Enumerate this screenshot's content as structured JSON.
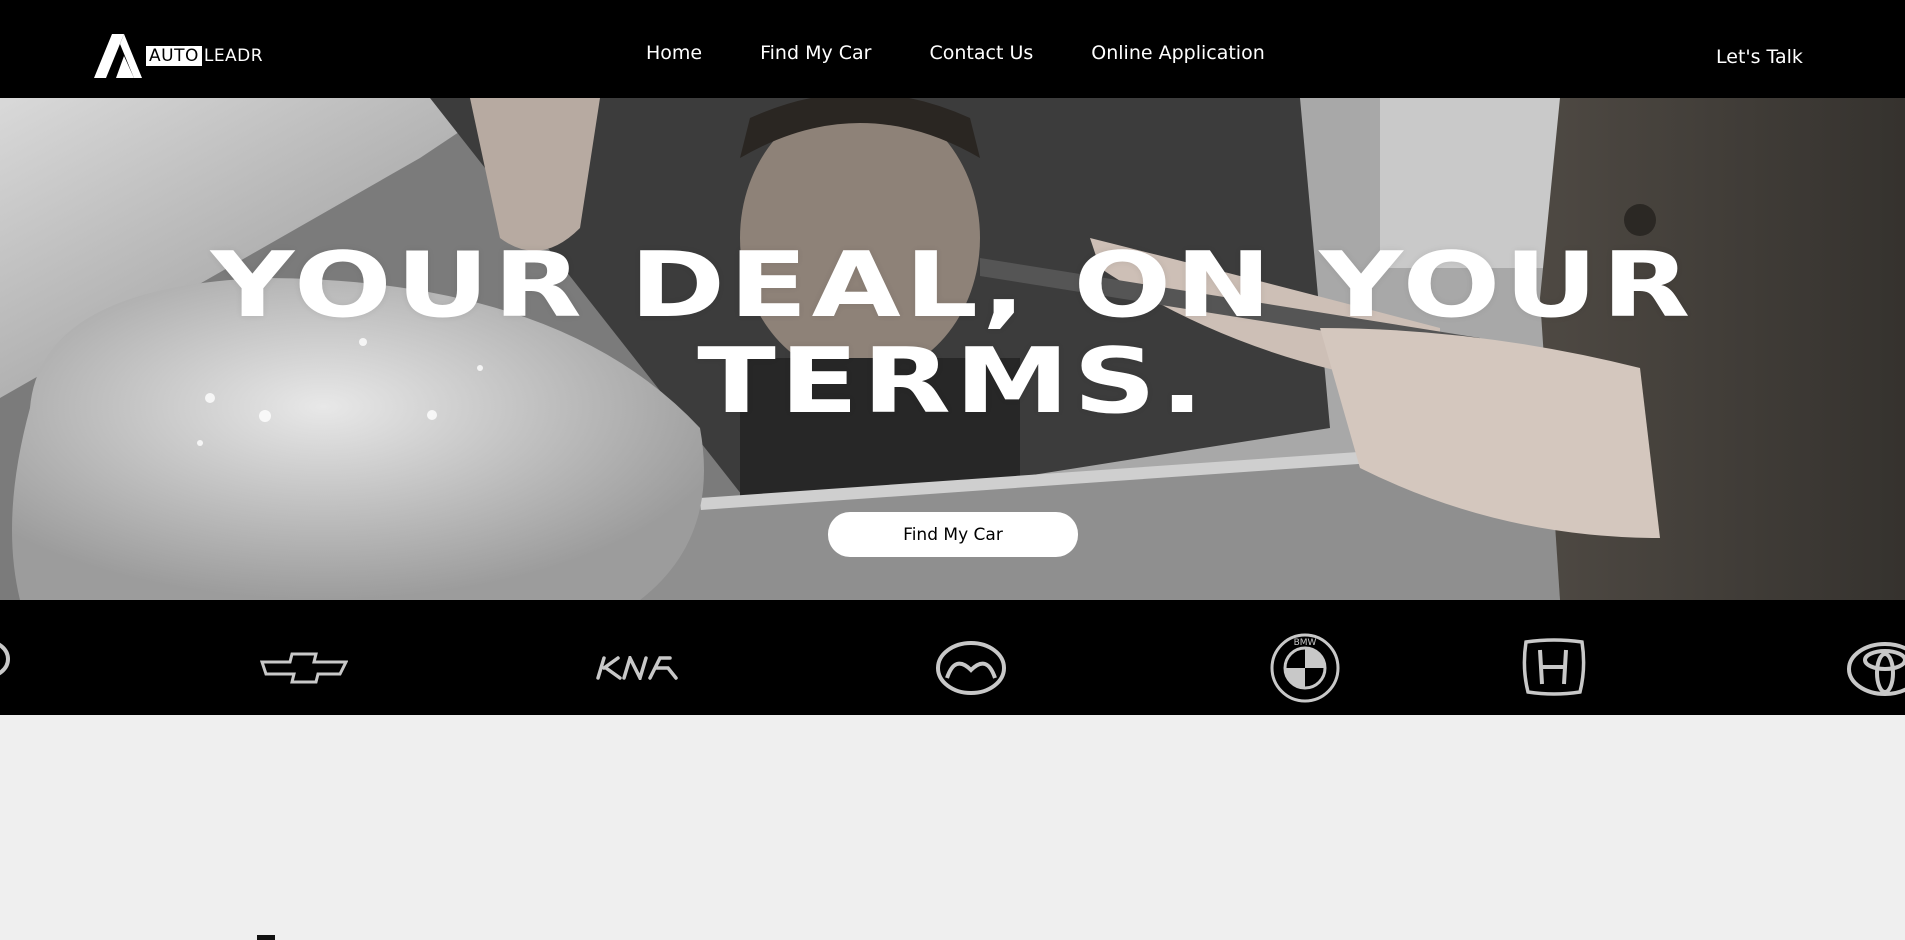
{
  "header": {
    "logo": {
      "part1": "AUTO",
      "part2": "LEADR"
    },
    "nav": [
      "Home",
      "Find My Car",
      "Contact Us",
      "Online Application"
    ],
    "cta": "Let's Talk"
  },
  "hero": {
    "title_line1": "YOUR DEAL, ON YOUR",
    "title_line2": "TERMS.",
    "button": "Find My Car"
  },
  "brands": [
    "partial-logo-icon",
    "chevrolet-icon",
    "kia-icon",
    "mazda-icon",
    "bmw-icon",
    "honda-icon",
    "toyota-icon"
  ],
  "colors": {
    "header_bg": "#000000",
    "brand_strip_bg": "#000000",
    "page_bg": "#efefef",
    "text_light": "#ffffff",
    "logo_gray": "#c8c8c8"
  }
}
